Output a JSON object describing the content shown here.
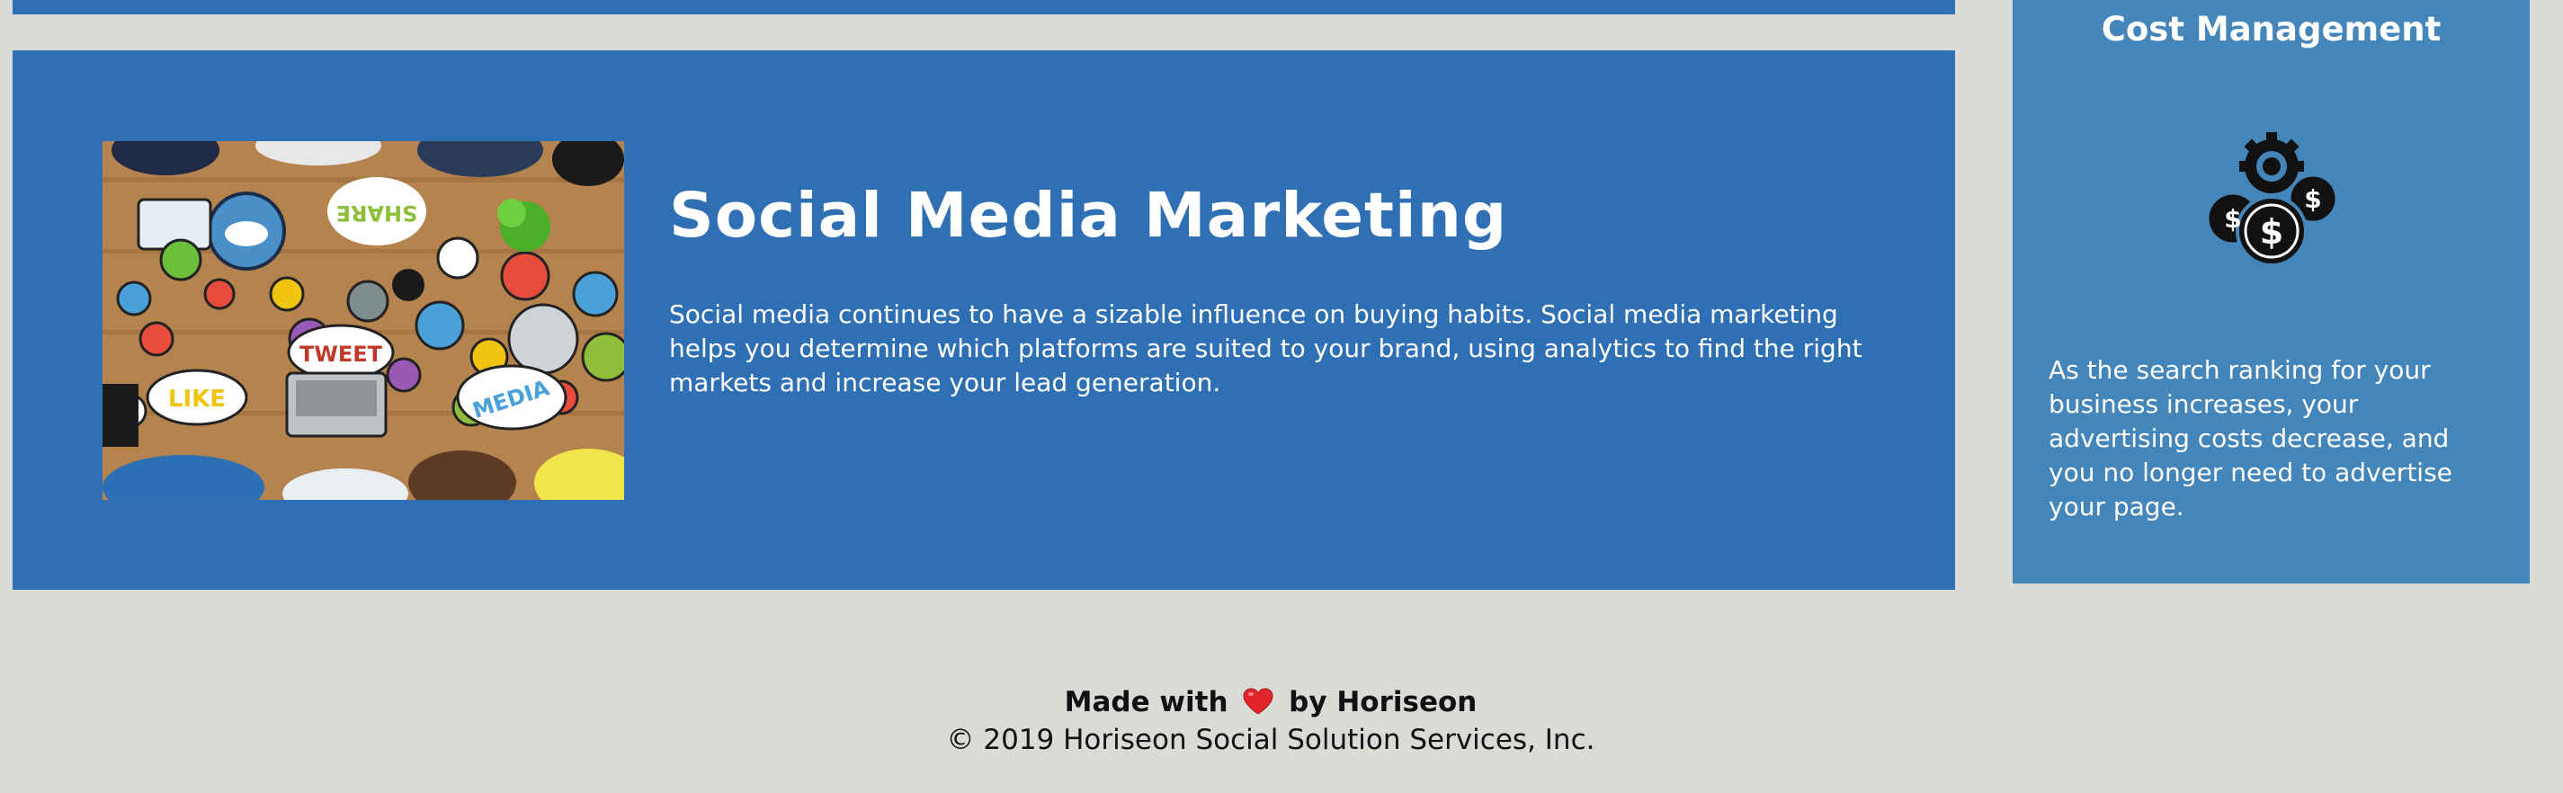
{
  "main": {
    "image_alt": "People at a table using social media icons",
    "image_words": [
      "SHARE",
      "TWEET",
      "LIKE",
      "MEDIA"
    ],
    "title": "Social Media Marketing",
    "text": "Social media continues to have a sizable influence on buying habits. Social media marketing helps you determine which platforms are suited to your brand, using analytics to find the right markets and increase your lead generation."
  },
  "sidebar": {
    "title": "Cost Management",
    "icon": "cost-management-icon",
    "text": "As the search ranking for your business increases, your advertising costs decrease, and you no longer need to advertise your page."
  },
  "footer": {
    "made_with": "Made with",
    "by": "by Horiseon",
    "heart_icon": "heart-icon",
    "copyright": "© 2019 Horiseon Social Solution Services, Inc."
  },
  "colors": {
    "background": "#d9dcd6",
    "primary_blue": "#2f70b5",
    "side_blue": "#4485ba"
  }
}
